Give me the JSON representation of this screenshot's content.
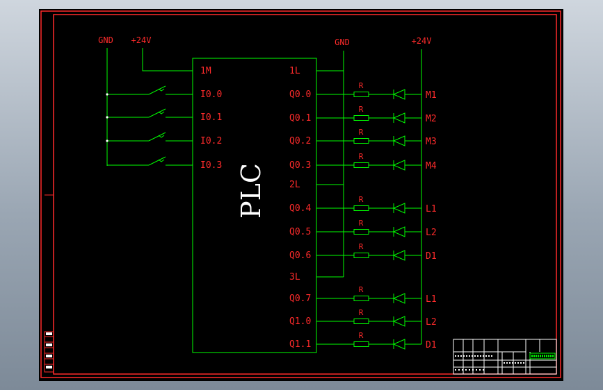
{
  "plc_label": "PLC",
  "left_supply": {
    "gnd": "GND",
    "v24": "+24V"
  },
  "right_supply": {
    "gnd": "GND",
    "v24": "+24V"
  },
  "inputs": {
    "common": "1M",
    "terminals": [
      "I0.0",
      "I0.1",
      "I0.2",
      "I0.3"
    ]
  },
  "outputs": {
    "commons": [
      "1L",
      "2L",
      "3L"
    ],
    "channels": [
      {
        "terminal": "Q0.0",
        "resistor": "R",
        "load": "M1"
      },
      {
        "terminal": "Q0.1",
        "resistor": "R",
        "load": "M2"
      },
      {
        "terminal": "Q0.2",
        "resistor": "R",
        "load": "M3"
      },
      {
        "terminal": "Q0.3",
        "resistor": "R",
        "load": "M4"
      },
      {
        "terminal": "Q0.4",
        "resistor": "R",
        "load": "L1"
      },
      {
        "terminal": "Q0.5",
        "resistor": "R",
        "load": "L2"
      },
      {
        "terminal": "Q0.6",
        "resistor": "R",
        "load": "D1"
      },
      {
        "terminal": "Q0.7",
        "resistor": "R",
        "load": "L1"
      },
      {
        "terminal": "Q1.0",
        "resistor": "R",
        "load": "L2"
      },
      {
        "terminal": "Q1.1",
        "resistor": "R",
        "load": "D1"
      }
    ]
  },
  "colors": {
    "wire": "#00ff00",
    "label": "#ff2b2b",
    "frame": "#ff2b2b",
    "text_white": "#ffffff"
  }
}
